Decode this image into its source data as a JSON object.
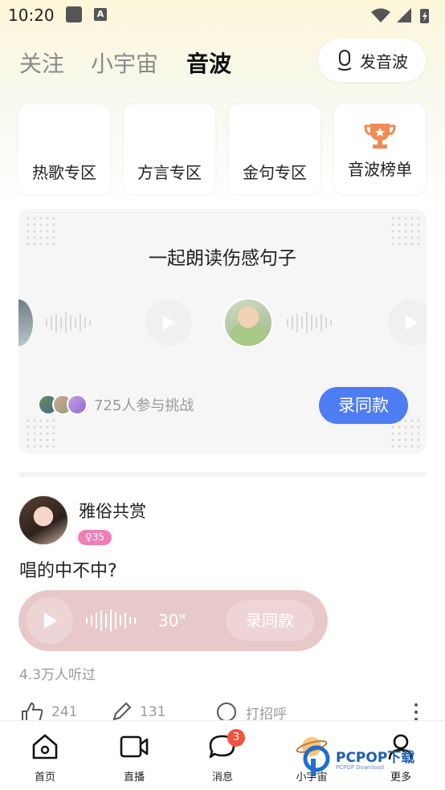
{
  "status_bar": {
    "time": "10:20",
    "a_icon": "A"
  },
  "top_nav": {
    "tabs": [
      {
        "label": "关注",
        "active": false
      },
      {
        "label": "小宇宙",
        "active": false
      },
      {
        "label": "音波",
        "active": true
      }
    ],
    "post_button": "发音波"
  },
  "categories": [
    {
      "label": "热歌专区"
    },
    {
      "label": "方言专区"
    },
    {
      "label": "金句专区"
    },
    {
      "label": "音波榜单",
      "icon": "trophy-icon"
    }
  ],
  "challenge": {
    "title": "一起朗读伤感句子",
    "participants_text": "725人参与挑战",
    "record_button": "录同款"
  },
  "post": {
    "username": "雅俗共赏",
    "level_badge": "35",
    "text": "唱的中不中?",
    "duration": "30\"",
    "record_button": "录同款",
    "listened": "4.3万人听过",
    "likes": "241",
    "comments": "131",
    "greet": "打招呼"
  },
  "bottom_nav": {
    "items": [
      {
        "label": "首页",
        "icon": "home-icon"
      },
      {
        "label": "直播",
        "icon": "video-icon"
      },
      {
        "label": "消息",
        "icon": "message-icon",
        "badge": "3"
      },
      {
        "label": "小宇宙",
        "icon": "planet-icon"
      },
      {
        "label": "更多",
        "icon": "person-icon"
      }
    ]
  },
  "watermark": {
    "title": "PCPOP下载",
    "subtitle": "PCPOP Download"
  },
  "colors": {
    "accent": "#4d7cf3",
    "badge_red": "#f2523f",
    "trophy": "#f08a55",
    "voice_pill": "#e8c9c9",
    "level_pink": "#ef7fb7"
  }
}
